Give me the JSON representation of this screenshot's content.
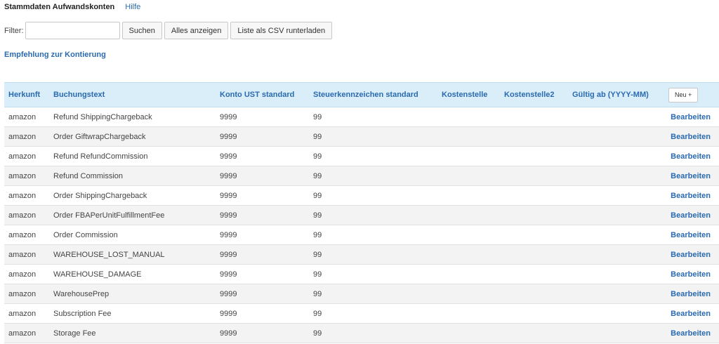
{
  "header": {
    "title": "Stammdaten Aufwandskonten",
    "help_label": "Hilfe"
  },
  "filter": {
    "label": "Filter:",
    "value": "",
    "placeholder": "",
    "search_label": "Suchen",
    "show_all_label": "Alles anzeigen",
    "csv_label": "Liste als CSV runterladen"
  },
  "recommendation_link": "Empfehlung zur Kontierung",
  "table": {
    "columns": {
      "herkunft": "Herkunft",
      "buchungstext": "Buchungstext",
      "konto": "Konto UST standard",
      "steuer": "Steuerkennzeichen standard",
      "kst": "Kostenstelle",
      "kst2": "Kostenstelle2",
      "gueltig": "Gültig ab (YYYY-MM)",
      "new_button": "Neu +"
    },
    "edit_label": "Bearbeiten",
    "rows": [
      {
        "herkunft": "amazon",
        "buchungstext": "Refund ShippingChargeback",
        "konto": "9999",
        "steuer": "99",
        "kst": "",
        "kst2": "",
        "gueltig": ""
      },
      {
        "herkunft": "amazon",
        "buchungstext": "Order GiftwrapChargeback",
        "konto": "9999",
        "steuer": "99",
        "kst": "",
        "kst2": "",
        "gueltig": ""
      },
      {
        "herkunft": "amazon",
        "buchungstext": "Refund RefundCommission",
        "konto": "9999",
        "steuer": "99",
        "kst": "",
        "kst2": "",
        "gueltig": ""
      },
      {
        "herkunft": "amazon",
        "buchungstext": "Refund Commission",
        "konto": "9999",
        "steuer": "99",
        "kst": "",
        "kst2": "",
        "gueltig": ""
      },
      {
        "herkunft": "amazon",
        "buchungstext": "Order ShippingChargeback",
        "konto": "9999",
        "steuer": "99",
        "kst": "",
        "kst2": "",
        "gueltig": ""
      },
      {
        "herkunft": "amazon",
        "buchungstext": "Order FBAPerUnitFulfillmentFee",
        "konto": "9999",
        "steuer": "99",
        "kst": "",
        "kst2": "",
        "gueltig": ""
      },
      {
        "herkunft": "amazon",
        "buchungstext": "Order Commission",
        "konto": "9999",
        "steuer": "99",
        "kst": "",
        "kst2": "",
        "gueltig": ""
      },
      {
        "herkunft": "amazon",
        "buchungstext": "WAREHOUSE_LOST_MANUAL",
        "konto": "9999",
        "steuer": "99",
        "kst": "",
        "kst2": "",
        "gueltig": ""
      },
      {
        "herkunft": "amazon",
        "buchungstext": "WAREHOUSE_DAMAGE",
        "konto": "9999",
        "steuer": "99",
        "kst": "",
        "kst2": "",
        "gueltig": ""
      },
      {
        "herkunft": "amazon",
        "buchungstext": "WarehousePrep",
        "konto": "9999",
        "steuer": "99",
        "kst": "",
        "kst2": "",
        "gueltig": ""
      },
      {
        "herkunft": "amazon",
        "buchungstext": "Subscription Fee",
        "konto": "9999",
        "steuer": "99",
        "kst": "",
        "kst2": "",
        "gueltig": ""
      },
      {
        "herkunft": "amazon",
        "buchungstext": "Storage Fee",
        "konto": "9999",
        "steuer": "99",
        "kst": "",
        "kst2": "",
        "gueltig": ""
      }
    ]
  }
}
